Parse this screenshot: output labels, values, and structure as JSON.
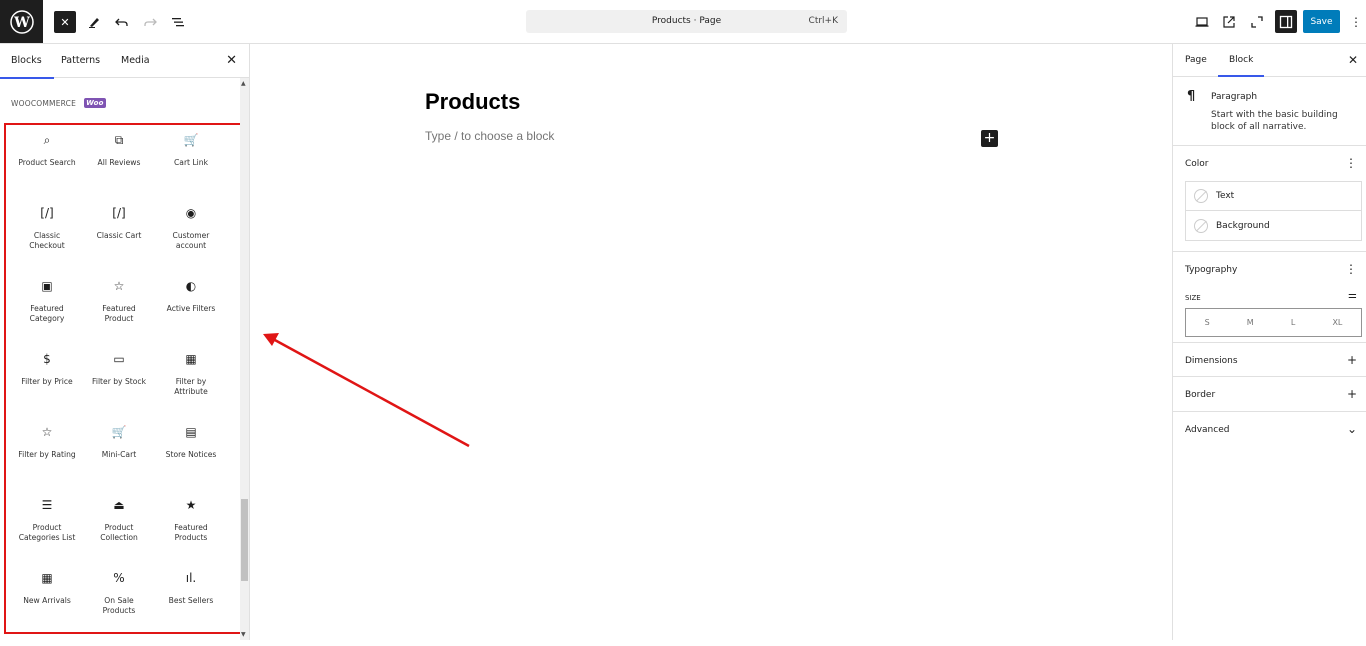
{
  "topbar": {
    "close_label": "✕",
    "document_title": "Products · Page",
    "shortcut": "Ctrl+K",
    "save_label": "Save",
    "more_label": "⋮",
    "accent": "#007cba"
  },
  "left_panel": {
    "tabs": [
      {
        "label": "Blocks",
        "active": true
      },
      {
        "label": "Patterns",
        "active": false
      },
      {
        "label": "Media",
        "active": false
      }
    ],
    "close_label": "✕",
    "section_title": "WOOCOMMERCE",
    "section_badge": "Woo",
    "blocks": [
      {
        "label": "Product Search",
        "icon": "search-icon",
        "glyph": "⌕"
      },
      {
        "label": "All Reviews",
        "icon": "reviews-icon",
        "glyph": "⧉"
      },
      {
        "label": "Cart Link",
        "icon": "cart-icon",
        "glyph": "🛒"
      },
      {
        "label": "Classic Checkout",
        "icon": "shortcode-icon",
        "glyph": "[/]"
      },
      {
        "label": "Classic Cart",
        "icon": "shortcode-icon",
        "glyph": "[/]"
      },
      {
        "label": "Customer account",
        "icon": "user-circle-icon",
        "glyph": "◉"
      },
      {
        "label": "Featured Category",
        "icon": "folder-star-icon",
        "glyph": "▣"
      },
      {
        "label": "Featured Product",
        "icon": "star-outline-icon",
        "glyph": "☆"
      },
      {
        "label": "Active Filters",
        "icon": "toggle-icon",
        "glyph": "◐"
      },
      {
        "label": "Filter by Price",
        "icon": "dollar-circle-icon",
        "glyph": "$"
      },
      {
        "label": "Filter by Stock",
        "icon": "box-icon",
        "glyph": "▭"
      },
      {
        "label": "Filter by Attribute",
        "icon": "grid-icon",
        "glyph": "▦"
      },
      {
        "label": "Filter by Rating",
        "icon": "star-outline-icon",
        "glyph": "☆"
      },
      {
        "label": "Mini-Cart",
        "icon": "mini-cart-icon",
        "glyph": "🛒"
      },
      {
        "label": "Store Notices",
        "icon": "notice-icon",
        "glyph": "▤"
      },
      {
        "label": "Product Categories List",
        "icon": "list-icon",
        "glyph": "☰"
      },
      {
        "label": "Product Collection",
        "icon": "collection-icon",
        "glyph": "⏏"
      },
      {
        "label": "Featured Products",
        "icon": "star-filled-icon",
        "glyph": "★"
      },
      {
        "label": "New Arrivals",
        "icon": "calendar-icon",
        "glyph": "▦"
      },
      {
        "label": "On Sale Products",
        "icon": "percent-icon",
        "glyph": "%"
      },
      {
        "label": "Best Sellers",
        "icon": "bar-chart-icon",
        "glyph": "ıl."
      }
    ]
  },
  "editor": {
    "title": "Products",
    "placeholder": "Type / to choose a block",
    "inserter_label": "+"
  },
  "right_panel": {
    "tabs": [
      {
        "label": "Page",
        "active": false
      },
      {
        "label": "Block",
        "active": true
      }
    ],
    "close_label": "✕",
    "block_card": {
      "icon": "¶",
      "name": "Paragraph",
      "description": "Start with the basic building block of all narrative."
    },
    "color": {
      "title": "Color",
      "options": [
        "Text",
        "Background"
      ]
    },
    "typography": {
      "title": "Typography",
      "size_label": "SIZE",
      "sizes": [
        "S",
        "M",
        "L",
        "XL"
      ]
    },
    "dimensions": {
      "title": "Dimensions",
      "action": "+"
    },
    "border": {
      "title": "Border",
      "action": "+"
    },
    "advanced": {
      "title": "Advanced",
      "action": "⌄"
    }
  },
  "annotation": {
    "color": "#e01515"
  }
}
